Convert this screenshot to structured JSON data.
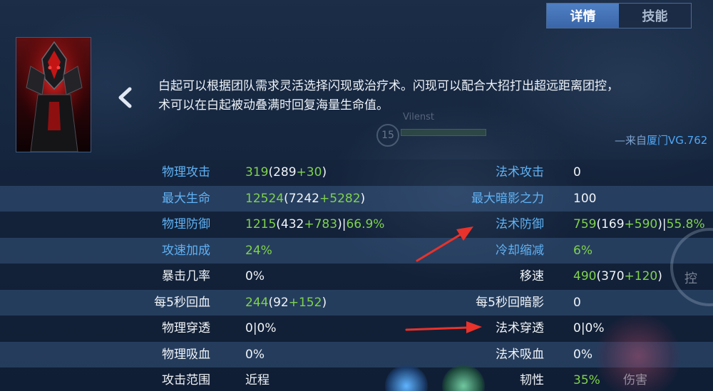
{
  "tabs": [
    {
      "label": "详情",
      "active": true
    },
    {
      "label": "技能",
      "active": false
    }
  ],
  "hero": {
    "portrait_icon": "hero-portrait"
  },
  "description": {
    "line1": "白起可以根据团队需求灵活选择闪现或治疗术。闪现可以配合大招打出超远距离团控，",
    "line2": "术可以在白起被动叠满时回复海量生命值。",
    "source_prefix": "—来自",
    "source_place": "厦门",
    "source_name": "VG.762"
  },
  "background": {
    "watermark_text": "Vilenst",
    "level_badge": "15"
  },
  "stats": [
    {
      "left": {
        "label": "物理攻击",
        "label_color": "blue",
        "total": "319",
        "open": "(",
        "base": "289",
        "plus": "+",
        "bonus": "30",
        "close": ")",
        "extra": ""
      },
      "right": {
        "label": "法术攻击",
        "label_color": "blue",
        "total": "0",
        "open": "",
        "base": "",
        "plus": "",
        "bonus": "",
        "close": "",
        "extra": ""
      }
    },
    {
      "left": {
        "label": "最大生命",
        "label_color": "blue",
        "total": "12524",
        "open": "(",
        "base": "7242",
        "plus": "+",
        "bonus": "5282",
        "close": ")",
        "extra": ""
      },
      "right": {
        "label": "最大暗影之力",
        "label_color": "blue",
        "total": "100",
        "open": "",
        "base": "",
        "plus": "",
        "bonus": "",
        "close": "",
        "extra": ""
      }
    },
    {
      "left": {
        "label": "物理防御",
        "label_color": "blue",
        "total": "1215",
        "open": "(",
        "base": "432",
        "plus": "+",
        "bonus": "783",
        "close": ")|",
        "extra": "66.9%"
      },
      "right": {
        "label": "法术防御",
        "label_color": "blue",
        "total": "759",
        "open": "(",
        "base": "169",
        "plus": "+",
        "bonus": "590",
        "close": ")|",
        "extra": "55.8%"
      }
    },
    {
      "left": {
        "label": "攻速加成",
        "label_color": "blue",
        "total": "24%",
        "open": "",
        "base": "",
        "plus": "",
        "bonus": "",
        "close": "",
        "extra": ""
      },
      "right": {
        "label": "冷却缩减",
        "label_color": "blue",
        "total": "6%",
        "open": "",
        "base": "",
        "plus": "",
        "bonus": "",
        "close": "",
        "extra": ""
      }
    },
    {
      "left": {
        "label": "暴击几率",
        "label_color": "white",
        "total": "0%",
        "open": "",
        "base": "",
        "plus": "",
        "bonus": "",
        "close": "",
        "extra": ""
      },
      "right": {
        "label": "移速",
        "label_color": "white",
        "total": "490",
        "open": "(",
        "base": "370",
        "plus": "+",
        "bonus": "120",
        "close": ")",
        "extra": ""
      }
    },
    {
      "left": {
        "label": "每5秒回血",
        "label_color": "white",
        "total": "244",
        "open": "(",
        "base": "92",
        "plus": "+",
        "bonus": "152",
        "close": ")",
        "extra": ""
      },
      "right": {
        "label": "每5秒回暗影",
        "label_color": "white",
        "total": "0",
        "open": "",
        "base": "",
        "plus": "",
        "bonus": "",
        "close": "",
        "extra": ""
      }
    },
    {
      "left": {
        "label": "物理穿透",
        "label_color": "white",
        "total": "0|0%",
        "open": "",
        "base": "",
        "plus": "",
        "bonus": "",
        "close": "",
        "extra": ""
      },
      "right": {
        "label": "法术穿透",
        "label_color": "white",
        "total": "0|0%",
        "open": "",
        "base": "",
        "plus": "",
        "bonus": "",
        "close": "",
        "extra": ""
      }
    },
    {
      "left": {
        "label": "物理吸血",
        "label_color": "white",
        "total": "0%",
        "open": "",
        "base": "",
        "plus": "",
        "bonus": "",
        "close": "",
        "extra": ""
      },
      "right": {
        "label": "法术吸血",
        "label_color": "white",
        "total": "0%",
        "open": "",
        "base": "",
        "plus": "",
        "bonus": "",
        "close": "",
        "extra": ""
      }
    },
    {
      "left": {
        "label": "攻击范围",
        "label_color": "white",
        "total": "近程",
        "open": "",
        "base": "",
        "plus": "",
        "bonus": "",
        "close": "",
        "extra": ""
      },
      "right": {
        "label": "韧性",
        "label_color": "white",
        "total": "35%",
        "open": "",
        "base": "",
        "plus": "",
        "bonus": "",
        "close": "",
        "extra": ""
      }
    }
  ],
  "green_totals": [
    "319",
    "12524",
    "1215",
    "759",
    "24%",
    "6%",
    "490",
    "244",
    "35%"
  ],
  "decor": {
    "skill_text": "控",
    "hurt_text": "伤害"
  },
  "colors": {
    "blue_label": "#5fb2f5",
    "green_value": "#7fd24e",
    "annotation_arrow": "#e8322b",
    "tab_active": "#4a78bd"
  }
}
